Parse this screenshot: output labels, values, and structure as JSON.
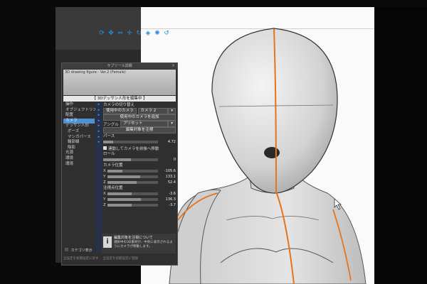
{
  "panel": {
    "title": "サブツール詳細",
    "close_label": "×",
    "preview_label": "3D drawing figure - Ver.2 (Female)",
    "banner": "【 3Dデッサン人形を編集中 】",
    "categories": [
      "操作",
      "オブジェクトリスト",
      "配置",
      "カメラ",
      "デッサン人形",
      "ポーズ",
      "マンガパース",
      "輪郭線",
      "陰影",
      "光源",
      "環境",
      "環境"
    ],
    "active_category": "カメラ",
    "camera_switch_header": "カメラの切り替え",
    "use_camera_label": "使用中のカメラ",
    "camera_value": "カメラ 2",
    "add_camera_button": "使用中のカメラを追加",
    "angle_label": "アングル",
    "angle_value": "プリセット",
    "edit_target_button": "編集対象を注視",
    "perspective_label": "パース",
    "perspective_value": "4.72",
    "link_camera_label": "連動してカメラを前後へ移動",
    "roll_label": "ロール",
    "roll_value": "0",
    "camera_pos_label": "カメラ位置",
    "cam_x_label": "X",
    "cam_x_value": "-105.6",
    "cam_y_label": "Y",
    "cam_y_value": "133.1",
    "cam_z_label": "Z",
    "cam_z_value": "52.4",
    "target_pos_label": "注視点位置",
    "tgt_x_label": "X",
    "tgt_x_value": "-3.6",
    "tgt_y_label": "Y",
    "tgt_y_value": "136.3",
    "tgt_z_label": "Z",
    "tgt_z_value": "-3.7",
    "info_title": "編集対象を注視について",
    "info_text": "選択中の3D素材が、中央に表示されるようにカメラが移動します。",
    "category_display": "カテゴリ表示",
    "bottom_left": "全設定を初期設定に戻す",
    "bottom_right": "全設定を初期設定に登録"
  },
  "tool_icons": [
    "rotate-camera-icon",
    "pan-camera-icon",
    "zoom-camera-icon",
    "move-object-icon",
    "rotate-object-icon",
    "scale-object-icon",
    "light-icon",
    "reset-icon"
  ],
  "colors": {
    "accent_blue": "#4f8fd4",
    "figure_guide_orange": "#e8741a"
  }
}
